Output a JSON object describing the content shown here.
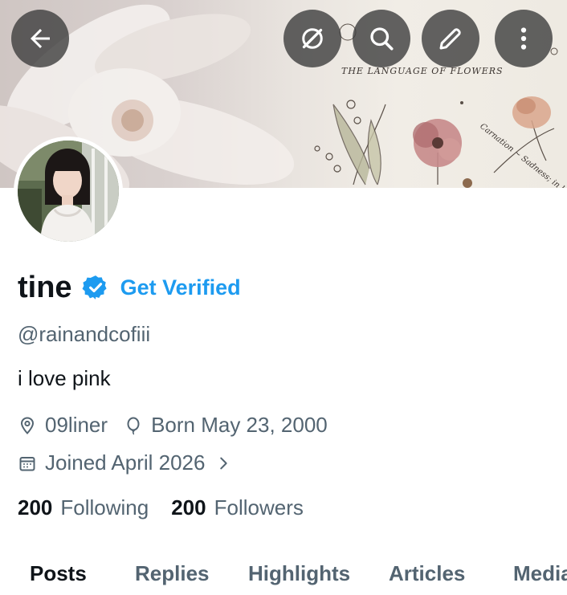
{
  "header": {
    "back_icon": "arrow-left-icon",
    "grok_icon": "grok-icon",
    "search_icon": "search-icon",
    "edit_icon": "pencil-icon",
    "more_icon": "more-vertical-icon"
  },
  "banner": {
    "text": "THE LANGUAGE OF FLOWERS",
    "note": "Carnation ~ Sadness; in love"
  },
  "profile": {
    "name": "tine",
    "verified_icon": "verified-badge-icon",
    "get_verified": "Get Verified",
    "handle": "@rainandcofiii",
    "bio": "i love pink",
    "location": "09liner",
    "birthday": "Born May 23, 2000",
    "joined": "Joined April 2026"
  },
  "stats": {
    "following_count": "200",
    "following_label": "Following",
    "followers_count": "200",
    "followers_label": "Followers"
  },
  "tabs": [
    "Posts",
    "Replies",
    "Highlights",
    "Articles",
    "Media"
  ],
  "active_tab": "Posts",
  "colors": {
    "accent": "#1d9bf0",
    "text": "#0f1419",
    "secondary_text": "#536471",
    "button_bg": "#414141"
  }
}
